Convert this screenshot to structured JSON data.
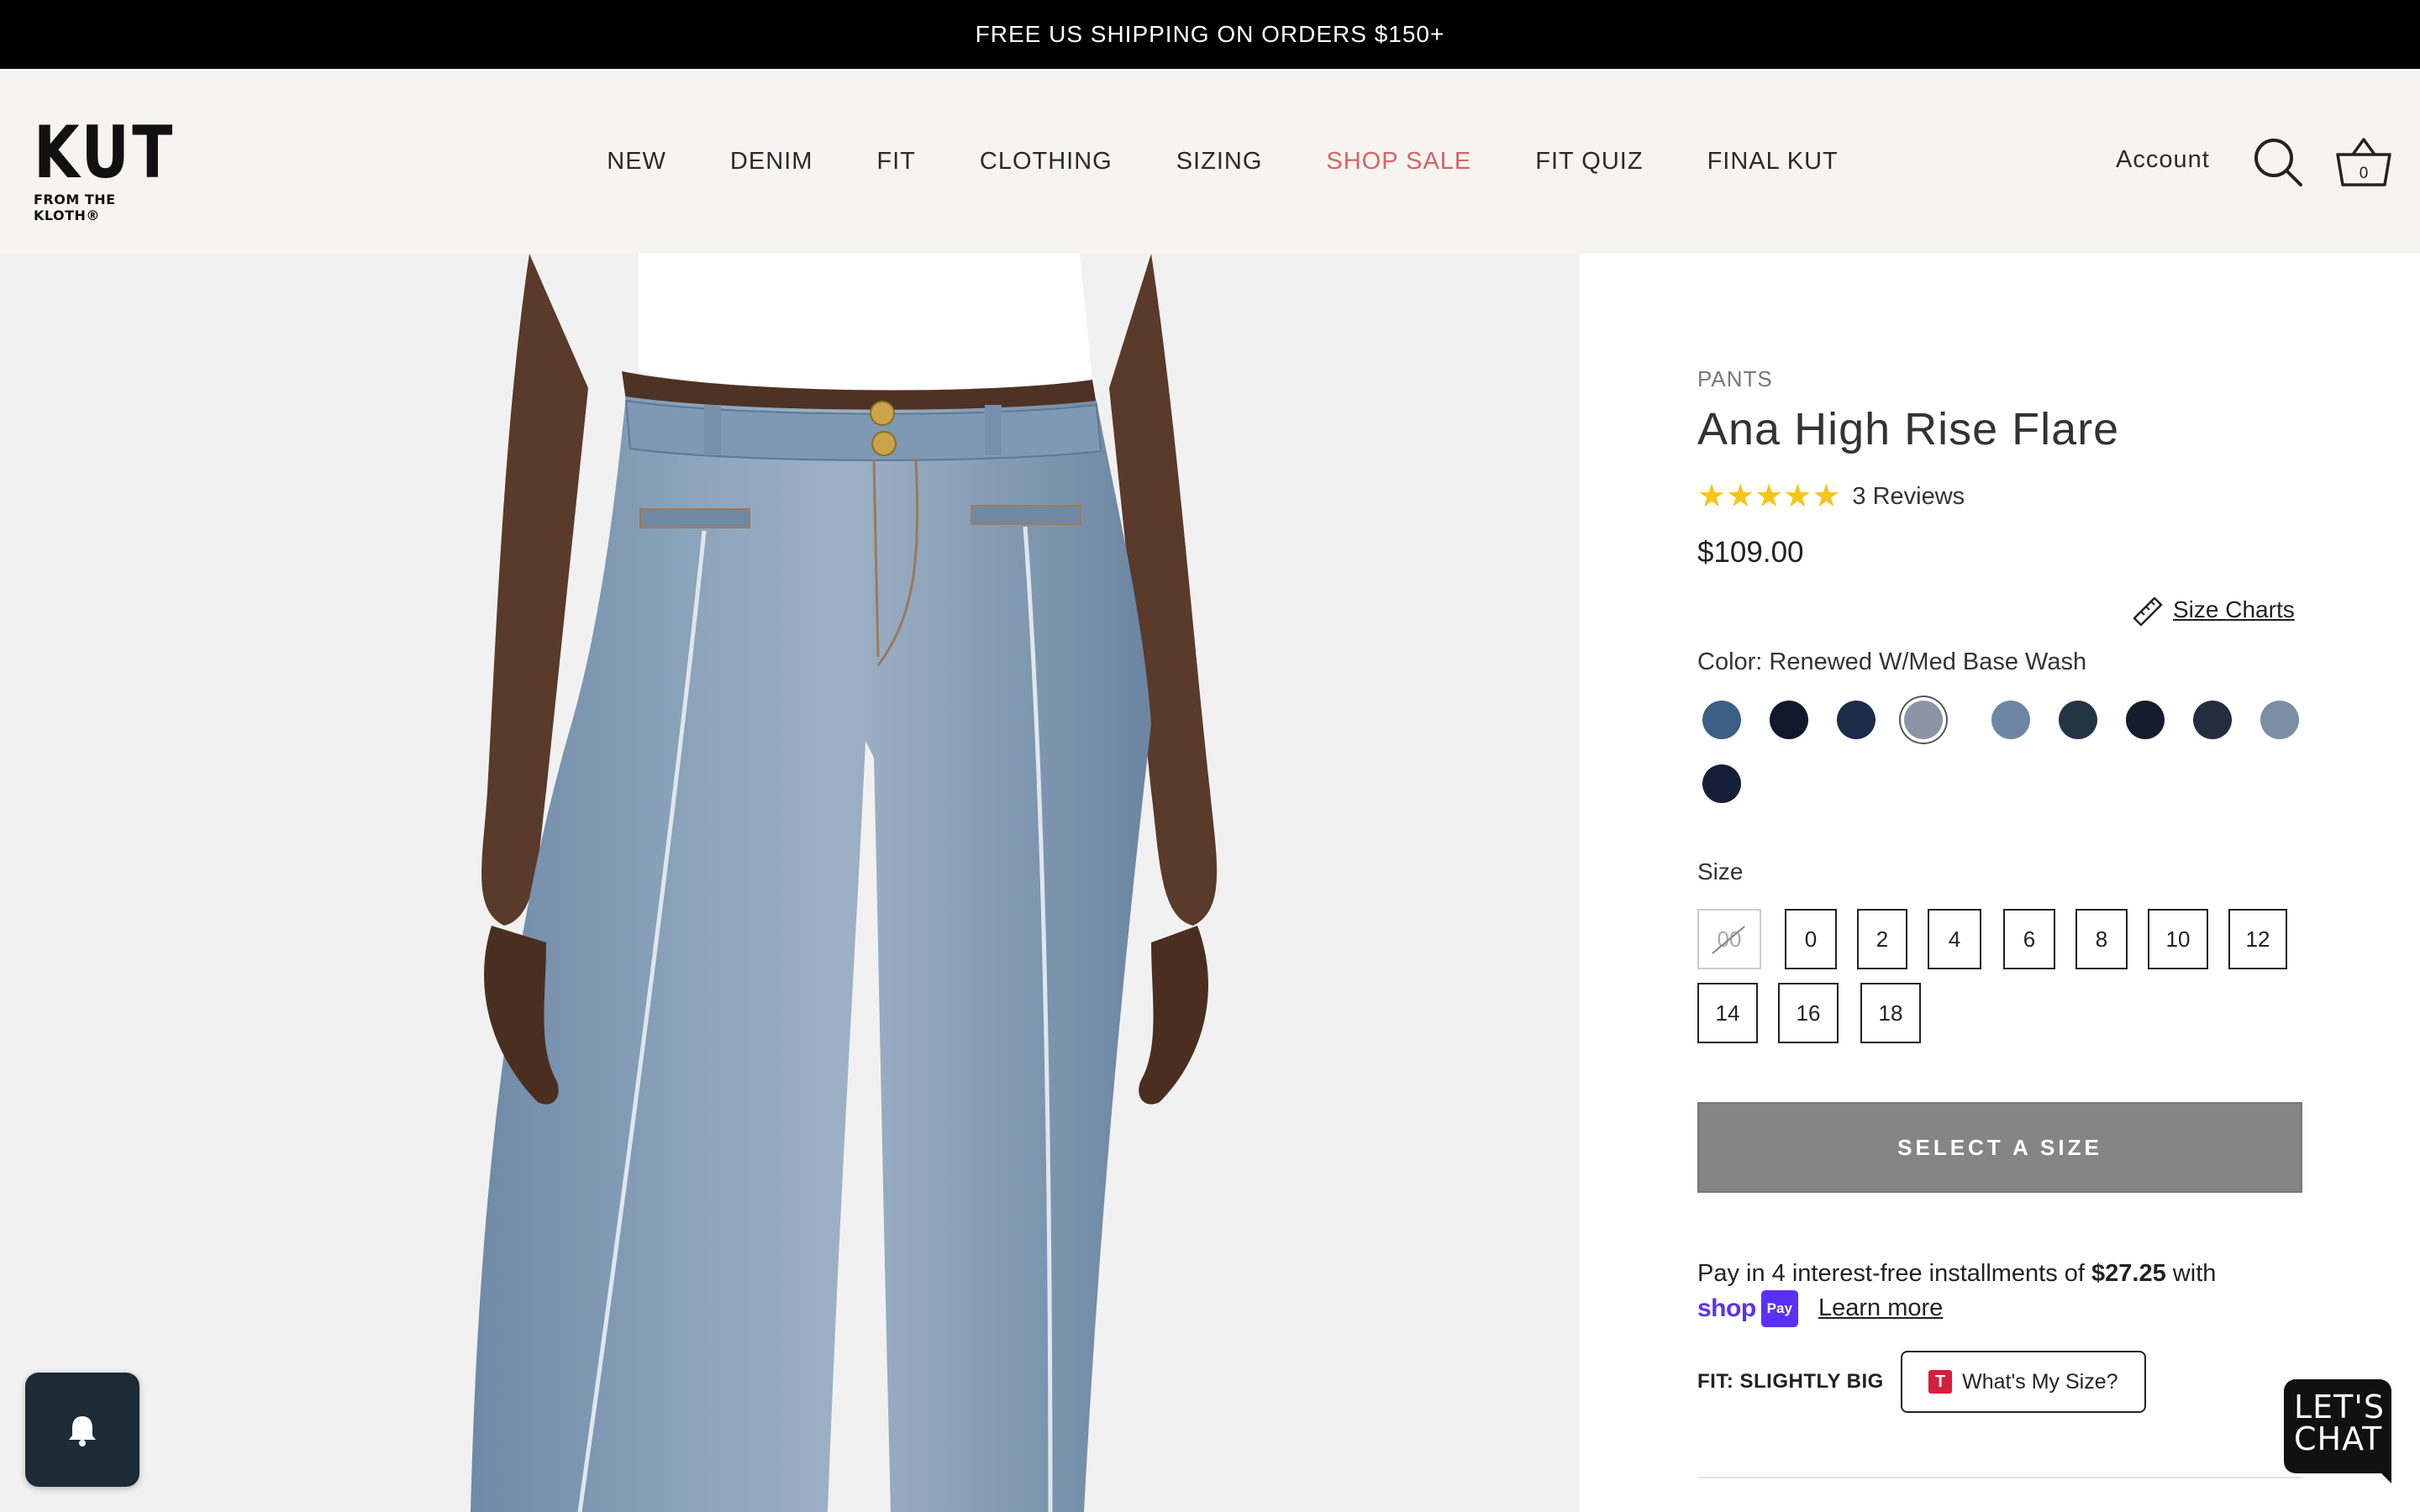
{
  "promo": {
    "text": "FREE US SHIPPING ON ORDERS $150+"
  },
  "header": {
    "logo_main": "KUT",
    "logo_sub": "FROM THE KLOTH®",
    "nav": [
      "NEW",
      "DENIM",
      "FIT",
      "CLOTHING",
      "SIZING",
      "SHOP SALE",
      "FIT QUIZ",
      "FINAL KUT"
    ],
    "sale_color": "#d9616a",
    "account": "Account",
    "cart_count": "0",
    "icons": [
      "search-icon",
      "cart-icon"
    ]
  },
  "gallery": {
    "thumbnail_count": 4,
    "selected_thumbnail": 1
  },
  "product": {
    "category": "PANTS",
    "title": "Ana High Rise Flare",
    "rating": 5,
    "reviews": "3 Reviews",
    "price": "$109.00",
    "size_charts": "Size Charts",
    "color_label": "Color: Renewed W/Med Base Wash",
    "swatches": [
      {
        "color": "#3d5e86"
      },
      {
        "color": "#0e1a2b"
      },
      {
        "color": "#1a2c48"
      },
      {
        "color": "#8a96a6",
        "selected": true
      },
      {
        "color": "#6e86a3"
      },
      {
        "color": "#243447"
      },
      {
        "color": "#141d2e"
      },
      {
        "color": "#232d40"
      },
      {
        "color": "#7b8ea4"
      },
      {
        "color": "#151f38"
      }
    ],
    "size_label": "Size",
    "sizes": [
      {
        "label": "00",
        "sold_out": true
      },
      {
        "label": "0"
      },
      {
        "label": "2"
      },
      {
        "label": "4"
      },
      {
        "label": "6"
      },
      {
        "label": "8"
      },
      {
        "label": "10"
      },
      {
        "label": "12"
      },
      {
        "label": "14"
      },
      {
        "label": "16"
      },
      {
        "label": "18"
      }
    ],
    "cta": "SELECT A SIZE",
    "pay_prefix": "Pay in 4 interest-free installments of ",
    "pay_amount": "$27.25",
    "pay_suffix": " with",
    "shop_pay": "shop",
    "shop_pay_badge": "Pay",
    "learn_more": "Learn more",
    "fit_label": "FIT: SLIGHTLY BIG",
    "fit_button": "What's My Size?",
    "fit_button_icon": "T"
  },
  "chat": {
    "label_line1": "LET'S",
    "label_line2": "CHAT"
  }
}
